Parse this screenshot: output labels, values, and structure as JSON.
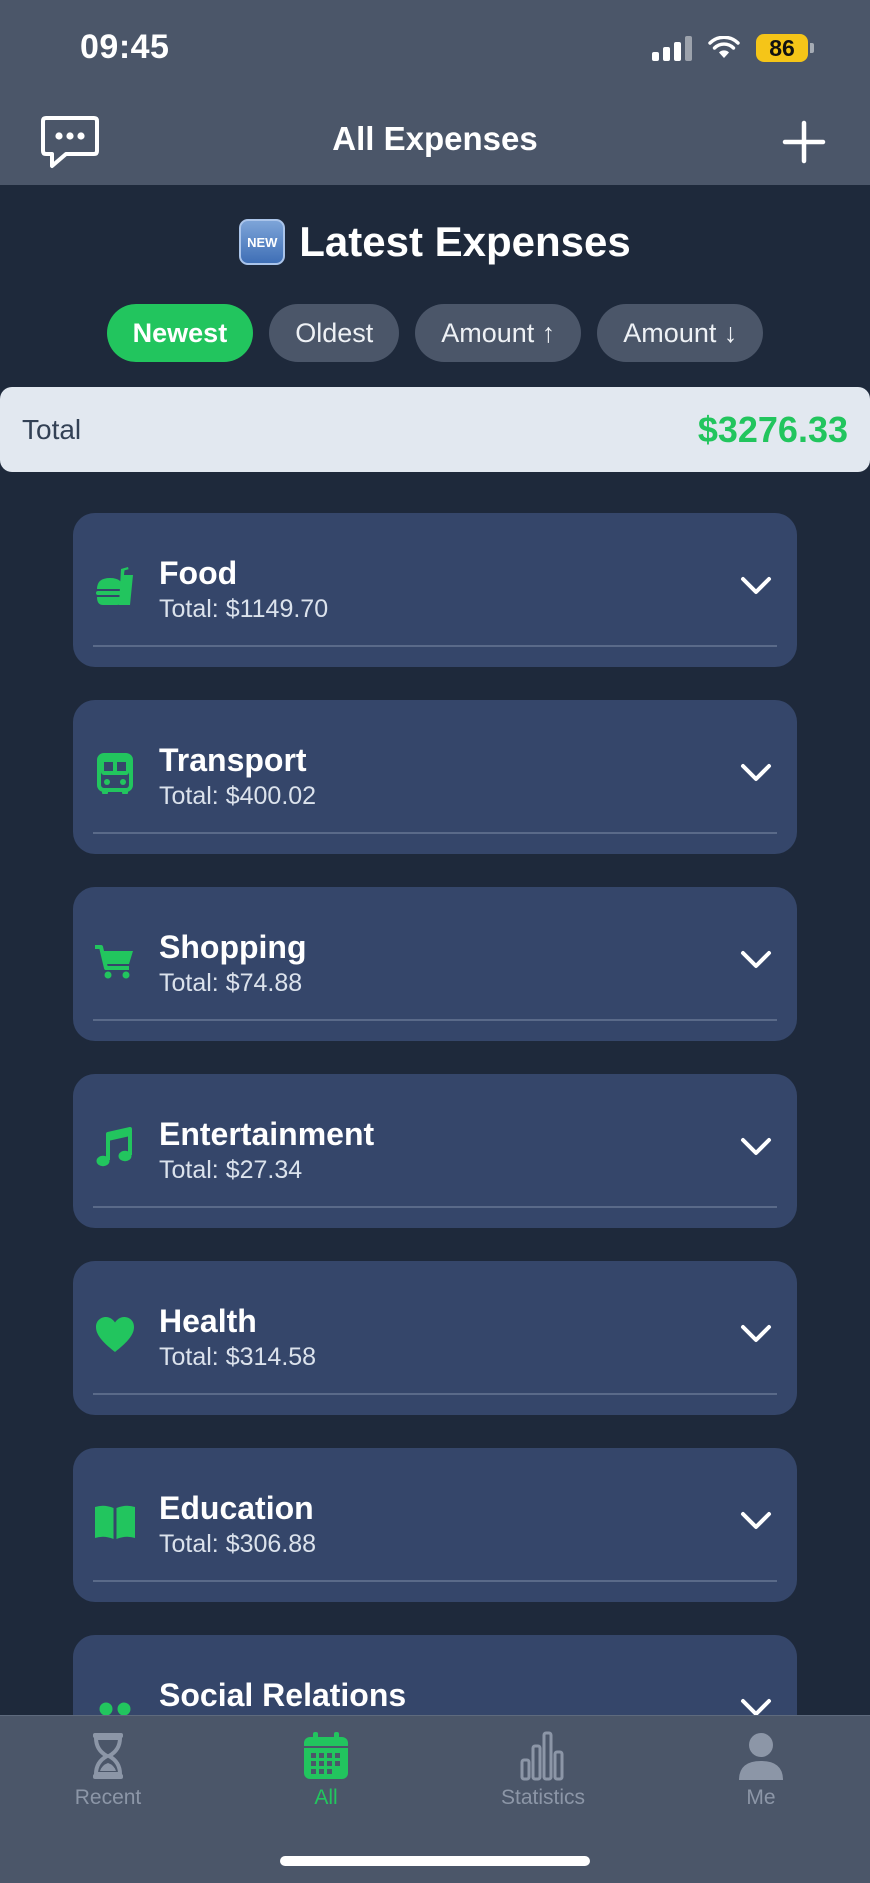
{
  "status_bar": {
    "time": "09:45",
    "battery": "86"
  },
  "nav": {
    "title": "All Expenses",
    "left_icon": "chat-bubble-icon",
    "right_icon": "plus-icon"
  },
  "heading": {
    "badge": "NEW",
    "title": "Latest Expenses"
  },
  "filters": [
    {
      "label": "Newest",
      "active": true
    },
    {
      "label": "Oldest",
      "active": false
    },
    {
      "label": "Amount ↑",
      "active": false
    },
    {
      "label": "Amount ↓",
      "active": false
    }
  ],
  "total": {
    "label": "Total",
    "value": "$3276.33"
  },
  "categories": [
    {
      "name": "Food",
      "total": "Total: $1149.70",
      "icon": "fast-food-icon"
    },
    {
      "name": "Transport",
      "total": "Total: $400.02",
      "icon": "bus-icon"
    },
    {
      "name": "Shopping",
      "total": "Total: $74.88",
      "icon": "cart-icon"
    },
    {
      "name": "Entertainment",
      "total": "Total: $27.34",
      "icon": "music-note-icon"
    },
    {
      "name": "Health",
      "total": "Total: $314.58",
      "icon": "heart-icon"
    },
    {
      "name": "Education",
      "total": "Total: $306.88",
      "icon": "book-icon"
    },
    {
      "name": "Social Relations",
      "total": "",
      "icon": "people-icon"
    }
  ],
  "tabs": [
    {
      "label": "Recent",
      "icon": "hourglass-icon",
      "active": false
    },
    {
      "label": "All",
      "icon": "calendar-icon",
      "active": true
    },
    {
      "label": "Statistics",
      "icon": "bar-chart-icon",
      "active": false
    },
    {
      "label": "Me",
      "icon": "person-icon",
      "active": false
    }
  ],
  "colors": {
    "accent": "#22c55e",
    "background": "#1e293b",
    "card": "#35466a",
    "bar": "#4b5669"
  }
}
